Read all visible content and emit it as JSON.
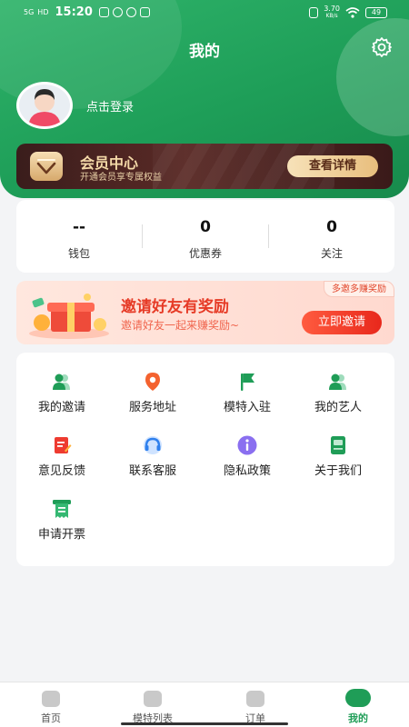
{
  "status_bar": {
    "network": "5G",
    "hd": "HD",
    "time": "15:20",
    "speed_value": "3.70",
    "speed_unit": "KB/s",
    "battery": "49"
  },
  "header": {
    "title": "我的",
    "login_text": "点击登录"
  },
  "member": {
    "title": "会员中心",
    "subtitle": "开通会员享专属权益",
    "button": "查看详情"
  },
  "stats": [
    {
      "value": "--",
      "label": "钱包"
    },
    {
      "value": "0",
      "label": "优惠券"
    },
    {
      "value": "0",
      "label": "关注"
    }
  ],
  "invite": {
    "tag": "多邀多赚奖励",
    "title": "邀请好友有奖励",
    "subtitle": "邀请好友一起来赚奖励~",
    "button": "立即邀请"
  },
  "grid_items": [
    {
      "label": "我的邀请",
      "icon": "users-icon"
    },
    {
      "label": "服务地址",
      "icon": "location-icon"
    },
    {
      "label": "模特入驻",
      "icon": "flag-icon"
    },
    {
      "label": "我的艺人",
      "icon": "artist-icon"
    },
    {
      "label": "意见反馈",
      "icon": "feedback-icon"
    },
    {
      "label": "联系客服",
      "icon": "headset-icon"
    },
    {
      "label": "隐私政策",
      "icon": "info-icon"
    },
    {
      "label": "关于我们",
      "icon": "about-icon"
    },
    {
      "label": "申请开票",
      "icon": "invoice-icon"
    }
  ],
  "bottom_nav": [
    {
      "label": "首页",
      "icon": "home-icon",
      "active": false
    },
    {
      "label": "模特列表",
      "icon": "model-list-icon",
      "active": false
    },
    {
      "label": "订单",
      "icon": "order-icon",
      "active": false
    },
    {
      "label": "我的",
      "icon": "profile-icon",
      "active": true
    }
  ],
  "colors": {
    "primary": "#1f9d57",
    "invite_red": "#e63a26",
    "member_gold": "#f4d9a8"
  }
}
